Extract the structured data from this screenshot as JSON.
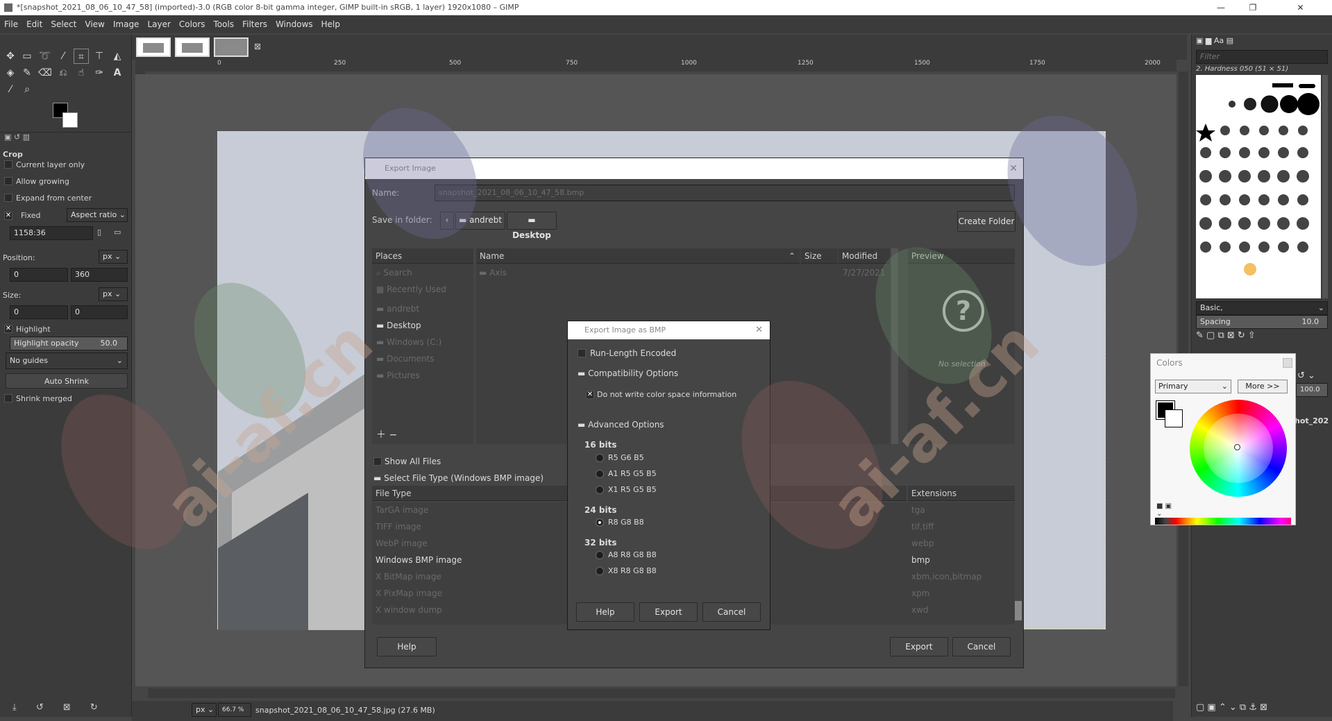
{
  "window": {
    "title": "*[snapshot_2021_08_06_10_47_58] (imported)-3.0 (RGB color 8-bit gamma integer, GIMP built-in sRGB, 1 layer) 1920x1080 – GIMP"
  },
  "menu": [
    "File",
    "Edit",
    "Select",
    "View",
    "Image",
    "Layer",
    "Colors",
    "Tools",
    "Filters",
    "Windows",
    "Help"
  ],
  "ruler": {
    "h_ticks": [
      "0",
      "250",
      "500",
      "750",
      "1000",
      "1250",
      "1500",
      "1750",
      "2000"
    ]
  },
  "tool_options": {
    "title": "Crop",
    "current_layer_only": "Current layer only",
    "allow_growing": "Allow growing",
    "expand_from_center": "Expand from center",
    "fixed": "Fixed",
    "aspect_ratio": "Aspect ratio",
    "ratio_value": "1158:36",
    "position_label": "Position:",
    "position_unit": "px",
    "pos_x": "0",
    "pos_y": "360",
    "size_label": "Size:",
    "size_unit": "px",
    "size_w": "0",
    "size_h": "0",
    "highlight": "Highlight",
    "highlight_opacity_label": "Highlight opacity",
    "highlight_opacity_value": "50.0",
    "guides": "No guides",
    "auto_shrink": "Auto Shrink",
    "shrink_merged": "Shrink merged"
  },
  "export_dialog": {
    "title": "Export Image",
    "name_label": "Name:",
    "name_value": "snapshot_2021_08_06_10_47_58.bmp",
    "save_in_label": "Save in folder:",
    "crumbs": [
      "andrebt",
      "Desktop"
    ],
    "create_folder": "Create Folder",
    "places_header": "Places",
    "places": [
      "Search",
      "Recently Used",
      "andrebt",
      "Desktop",
      "Windows (C:)",
      "Documents",
      "Pictures"
    ],
    "name_header": "Name",
    "size_header": "Size",
    "modified_header": "Modified",
    "files": [
      {
        "name": "Axis",
        "modified": "7/27/2021"
      }
    ],
    "preview_header": "Preview",
    "no_selection": "No selection",
    "show_all_files": "Show All Files",
    "select_file_type": "Select File Type (Windows BMP image)",
    "file_type_header": "File Type",
    "extensions_header": "Extensions",
    "file_types": [
      {
        "name": "TarGA image",
        "ext": "tga"
      },
      {
        "name": "TIFF image",
        "ext": "tif,tiff"
      },
      {
        "name": "WebP image",
        "ext": "webp"
      },
      {
        "name": "Windows BMP image",
        "ext": "bmp"
      },
      {
        "name": "X BitMap image",
        "ext": "xbm,icon,bitmap"
      },
      {
        "name": "X PixMap image",
        "ext": "xpm"
      },
      {
        "name": "X window dump",
        "ext": "xwd"
      }
    ],
    "help": "Help",
    "export": "Export",
    "cancel": "Cancel"
  },
  "bmp_dialog": {
    "title": "Export Image as BMP",
    "rle": "Run-Length Encoded",
    "compat": "Compatibility Options",
    "no_color_space": "Do not write color space information",
    "advanced": "Advanced Options",
    "b16": "16 bits",
    "b16_opts": [
      "R5 G6 B5",
      "A1 R5 G5 B5",
      "X1 R5 G5 B5"
    ],
    "b24": "24 bits",
    "b24_opts": [
      "R8 G8 B8"
    ],
    "b32": "32 bits",
    "b32_opts": [
      "A8 R8 G8 B8",
      "X8 R8 G8 B8"
    ],
    "help": "Help",
    "export": "Export",
    "cancel": "Cancel"
  },
  "brushes": {
    "filter": "Filter",
    "name": "2. Hardness 050 (51 × 51)",
    "preset": "Basic,",
    "spacing_label": "Spacing",
    "spacing_value": "10.0",
    "opacity_value": "100.0",
    "layer_name": "hot_202"
  },
  "colors_dialog": {
    "title": "Colors",
    "mode": "Primary",
    "more": "More >>"
  },
  "status": {
    "unit": "px",
    "zoom": "66.7 %",
    "file": "snapshot_2021_08_06_10_47_58.jpg (27.6 MB)"
  },
  "colors": {
    "accent": "#f0f0f0",
    "bg": "#454545"
  }
}
